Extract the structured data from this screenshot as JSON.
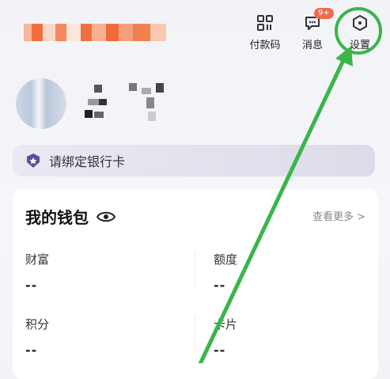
{
  "header": {
    "actions": [
      {
        "id": "pay-code",
        "label": "付款码",
        "icon": "qr-grid-icon"
      },
      {
        "id": "messages",
        "label": "消息",
        "icon": "chat-bubble-icon",
        "badge": "9+"
      },
      {
        "id": "settings",
        "label": "设置",
        "icon": "hexagon-settings-icon"
      }
    ]
  },
  "bank": {
    "label": "请绑定银行卡"
  },
  "wallet": {
    "title": "我的钱包",
    "more": "查看更多 >",
    "items": [
      {
        "key": "财富",
        "value": "--"
      },
      {
        "key": "额度",
        "value": "--"
      },
      {
        "key": "积分",
        "value": "--"
      },
      {
        "key": "卡片",
        "value": "--"
      }
    ]
  },
  "colors": {
    "accent_annotation": "#3ab54a",
    "badge": "#f06a4a"
  }
}
